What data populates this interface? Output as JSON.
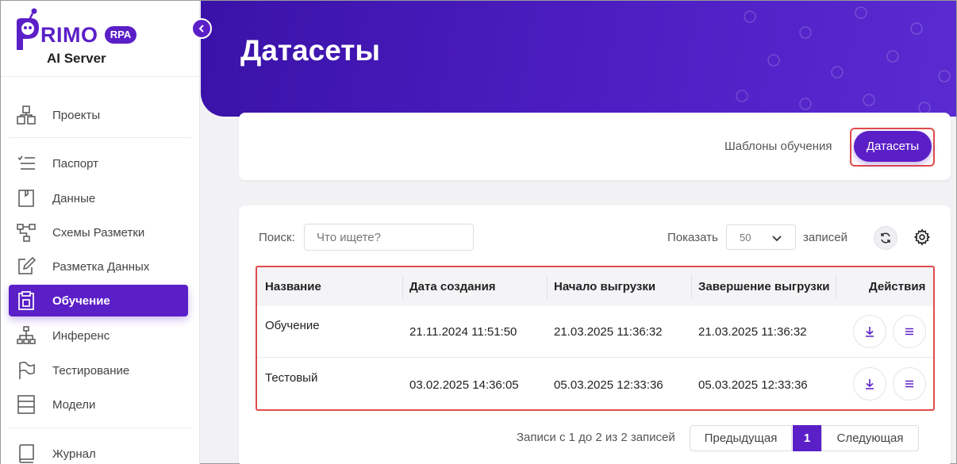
{
  "brand": {
    "name": "RIMO",
    "badge": "RPA",
    "subtitle": "AI Server"
  },
  "sidebar": {
    "items": [
      {
        "label": "Проекты",
        "icon": "projects-icon"
      },
      {
        "label": "Паспорт",
        "icon": "passport-icon"
      },
      {
        "label": "Данные",
        "icon": "data-icon"
      },
      {
        "label": "Схемы Разметки",
        "icon": "schema-icon"
      },
      {
        "label": "Разметка Данных",
        "icon": "annotation-icon"
      },
      {
        "label": "Обучение",
        "icon": "training-icon",
        "active": true
      },
      {
        "label": "Инференс",
        "icon": "inference-icon"
      },
      {
        "label": "Тестирование",
        "icon": "testing-icon"
      },
      {
        "label": "Модели",
        "icon": "models-icon"
      },
      {
        "label": "Журнал",
        "icon": "journal-icon"
      }
    ]
  },
  "header": {
    "title": "Датасеты"
  },
  "tabs": {
    "templates": "Шаблоны обучения",
    "datasets": "Датасеты"
  },
  "toolbar": {
    "search_label": "Поиск:",
    "search_placeholder": "Что ищете?",
    "show_label": "Показать",
    "page_size": "50",
    "records_label": "записей"
  },
  "table": {
    "columns": [
      "Название",
      "Дата создания",
      "Начало выгрузки",
      "Завершение выгрузки",
      "Действия"
    ],
    "rows": [
      {
        "name": "Обучение",
        "created": "21.11.2024 11:51:50",
        "start": "21.03.2025 11:36:32",
        "end": "21.03.2025 11:36:32"
      },
      {
        "name": "Тестовый",
        "created": "03.02.2025 14:36:05",
        "start": "05.03.2025 12:33:36",
        "end": "05.03.2025 12:33:36"
      }
    ]
  },
  "pagination": {
    "info": "Записи с 1 до 2 из 2 записей",
    "prev": "Предыдущая",
    "current": "1",
    "next": "Следующая"
  },
  "colors": {
    "accent": "#5b1fc7",
    "highlight": "#e04b4b"
  }
}
